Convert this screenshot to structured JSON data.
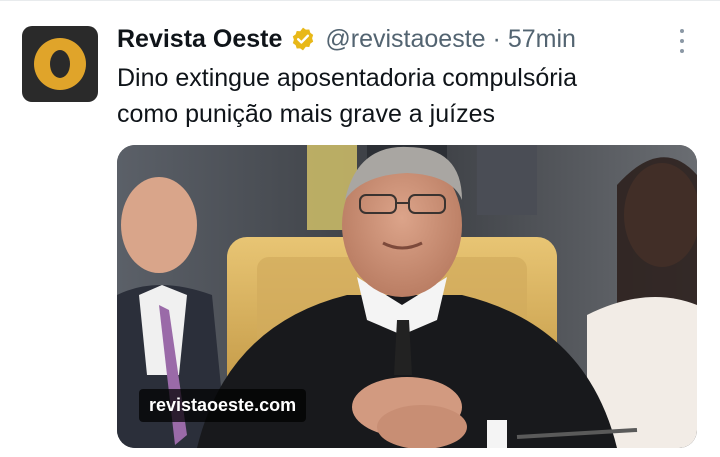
{
  "tweet": {
    "author_name": "Revista Oeste",
    "handle": "@revistaoeste",
    "separator": "·",
    "time": "57min",
    "text_line1": "Dino extingue aposentadoria compulsória",
    "text_line2": "como punição mais grave a juízes",
    "verified": true,
    "verified_color": "#e8b818",
    "media": {
      "watermark": "revistaoeste.com"
    }
  },
  "icons": {
    "verified": "verified-badge-icon",
    "more": "more-options-icon"
  },
  "colors": {
    "text": "#0f1419",
    "secondary": "#536471",
    "avatar_bg": "#2a2a2a",
    "avatar_accent": "#e0a42a"
  }
}
